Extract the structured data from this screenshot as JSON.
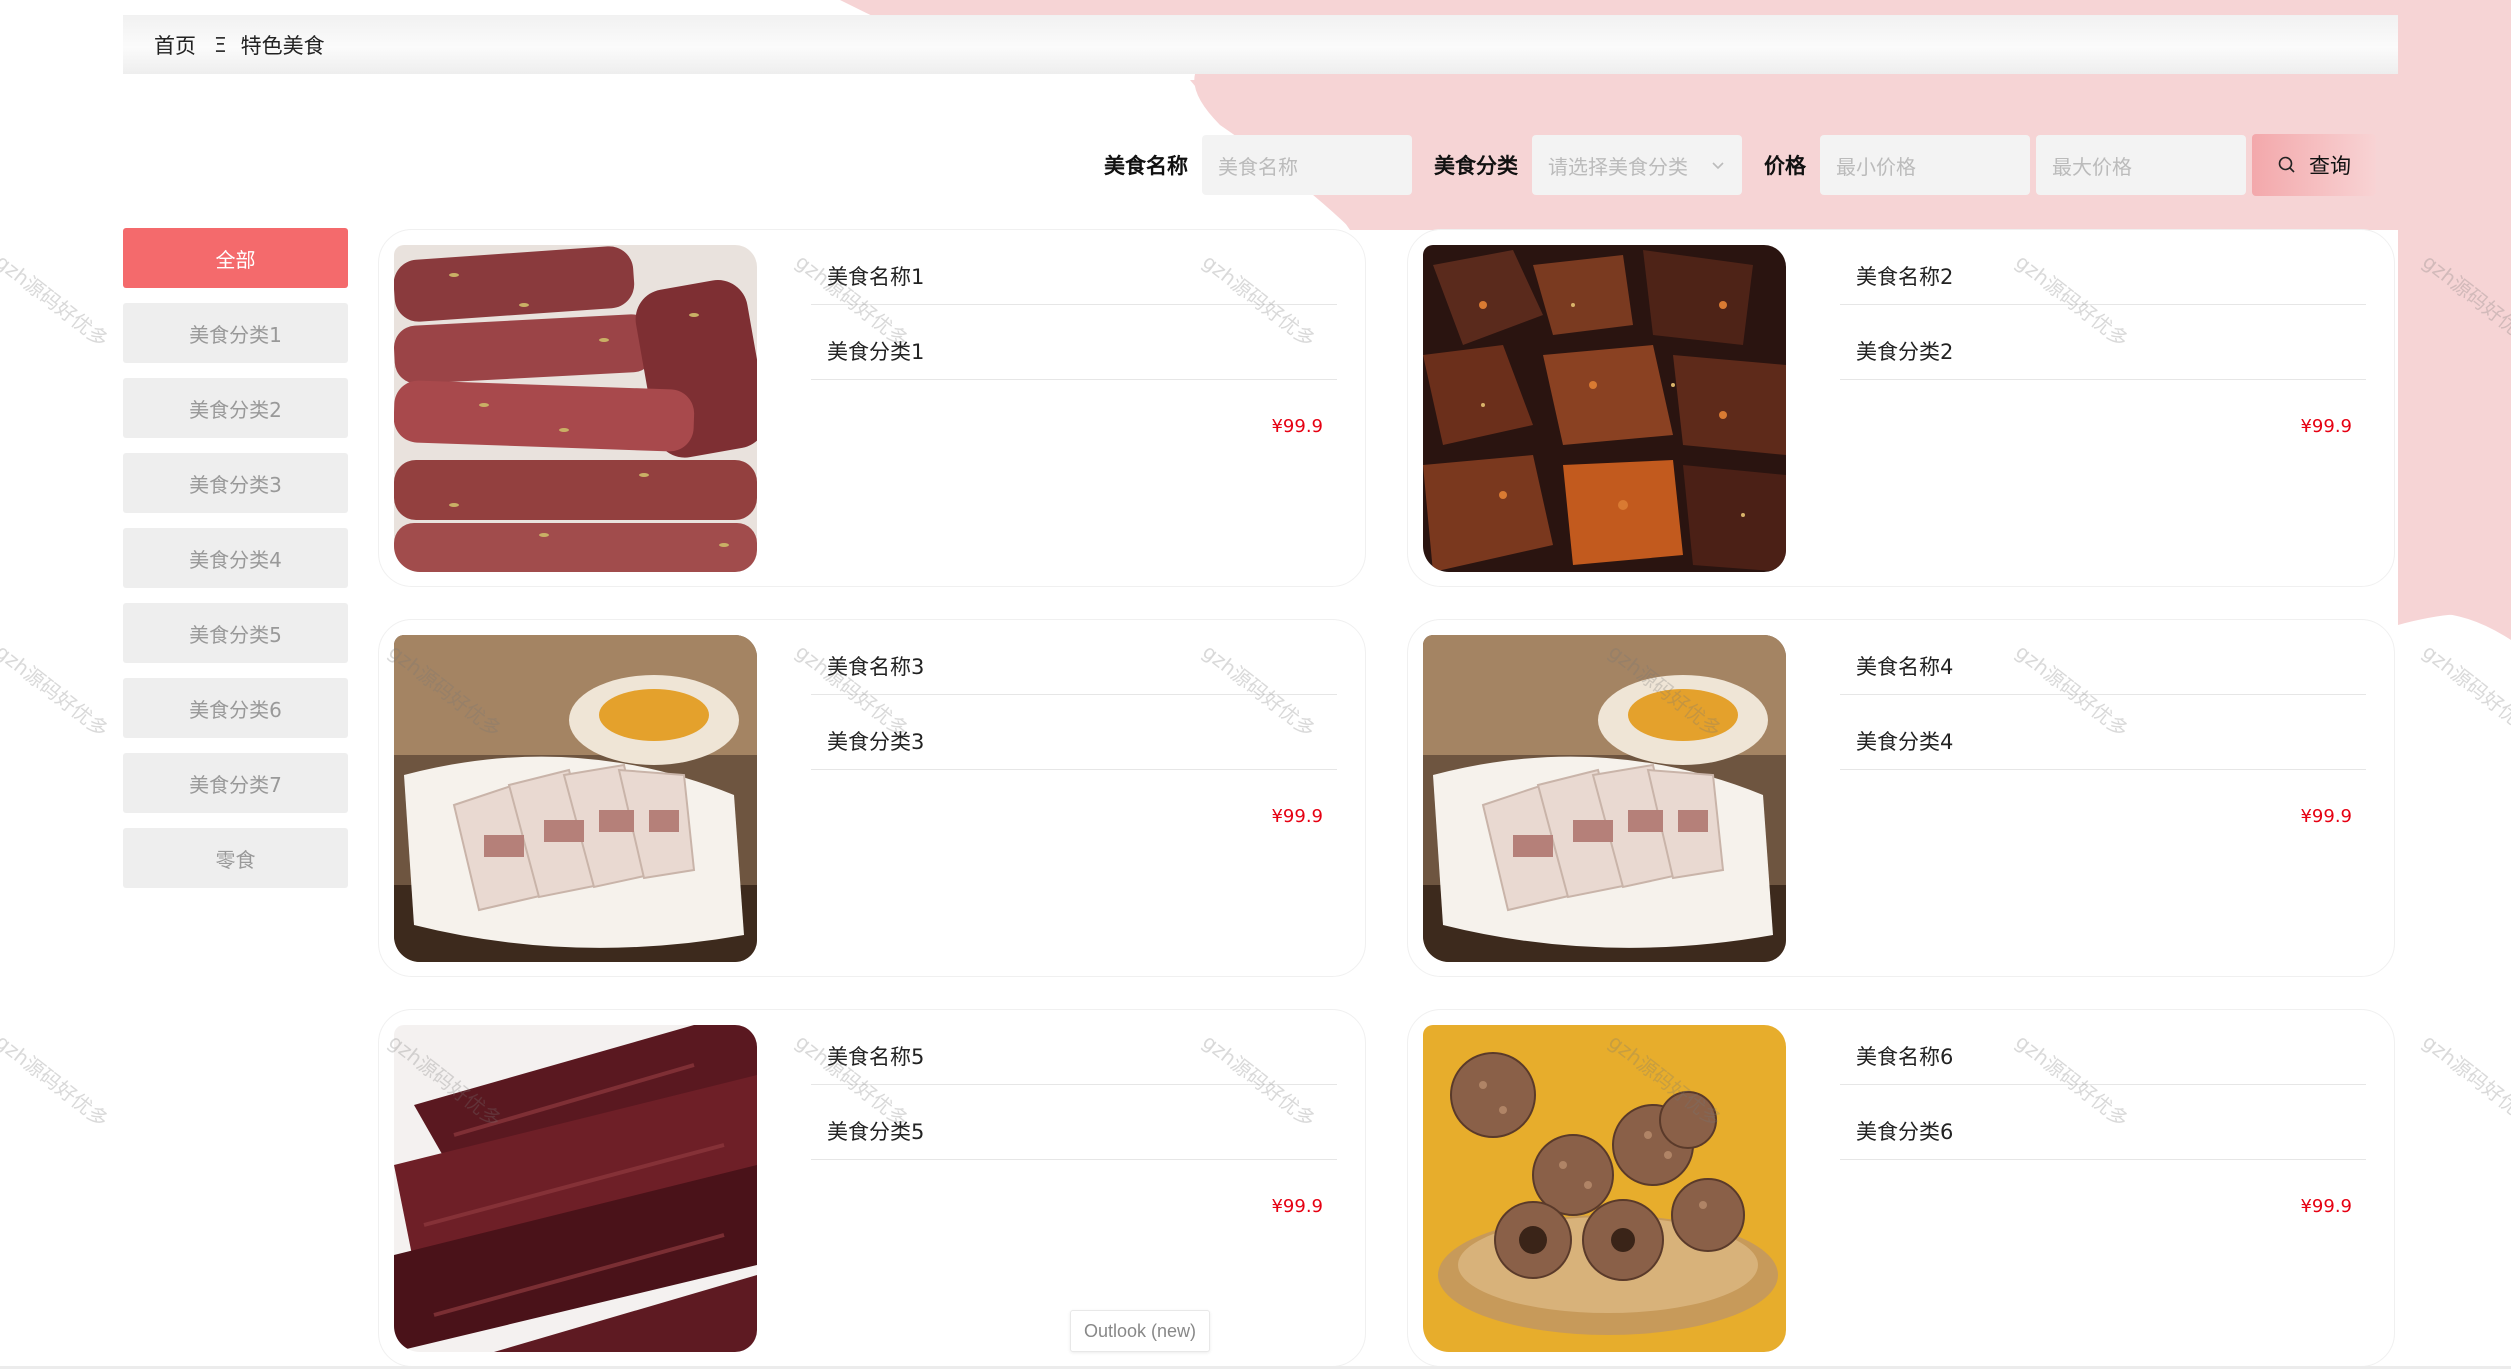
{
  "breadcrumb": {
    "home": "首页",
    "separator": "Ξ",
    "current": "特色美食"
  },
  "search": {
    "name_label": "美食名称",
    "name_placeholder": "美食名称",
    "category_label": "美食分类",
    "category_placeholder": "请选择美食分类",
    "price_label": "价格",
    "min_price_placeholder": "最小价格",
    "max_price_placeholder": "最大价格",
    "query_label": "查询"
  },
  "sidebar": {
    "items": [
      {
        "label": "全部",
        "active": true
      },
      {
        "label": "美食分类1"
      },
      {
        "label": "美食分类2"
      },
      {
        "label": "美食分类3"
      },
      {
        "label": "美食分类4"
      },
      {
        "label": "美食分类5"
      },
      {
        "label": "美食分类6"
      },
      {
        "label": "美食分类7"
      },
      {
        "label": "零食"
      }
    ]
  },
  "foods": [
    {
      "name": "美食名称1",
      "category": "美食分类1",
      "price": "¥99.9",
      "image": "dried-beef"
    },
    {
      "name": "美食名称2",
      "category": "美食分类2",
      "price": "¥99.9",
      "image": "spicy-dried-meat"
    },
    {
      "name": "美食名称3",
      "category": "美食分类3",
      "price": "¥99.9",
      "image": "sliced-pork-jelly"
    },
    {
      "name": "美食名称4",
      "category": "美食分类4",
      "price": "¥99.9",
      "image": "sliced-pork-jelly"
    },
    {
      "name": "美食名称5",
      "category": "美食分类5",
      "price": "¥99.9",
      "image": "cured-beef-strips"
    },
    {
      "name": "美食名称6",
      "category": "美食分类6",
      "price": "¥99.9",
      "image": "dried-longan"
    }
  ],
  "watermark": "gzh源码好优多",
  "tooltip": "Outlook (new)",
  "colors": {
    "accent": "#f46a6c",
    "price": "#e60012",
    "background_shape": "#f6d3d4",
    "sidebar_inactive": "#eeeeee"
  }
}
